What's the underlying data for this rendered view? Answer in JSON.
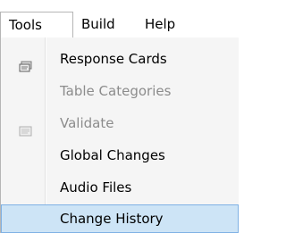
{
  "menubar": {
    "items": [
      {
        "label": "Tools",
        "state": "open"
      },
      {
        "label": "Build"
      },
      {
        "label": "Help"
      }
    ]
  },
  "dropdown": {
    "items": [
      {
        "label": "Response Cards",
        "enabled": true,
        "icon": "cards-icon"
      },
      {
        "label": "Table Categories",
        "enabled": false
      },
      {
        "label": "Validate",
        "enabled": false,
        "icon": "validate-icon"
      },
      {
        "label": "Global Changes",
        "enabled": true
      },
      {
        "label": "Audio Files",
        "enabled": true
      },
      {
        "label": "Change History",
        "enabled": true,
        "highlighted": true
      }
    ]
  },
  "colors": {
    "menu_background": "#f5f5f5",
    "highlight_fill": "#cde4f6",
    "highlight_border": "#7fb1e4",
    "disabled_text": "#8c8c8c"
  }
}
